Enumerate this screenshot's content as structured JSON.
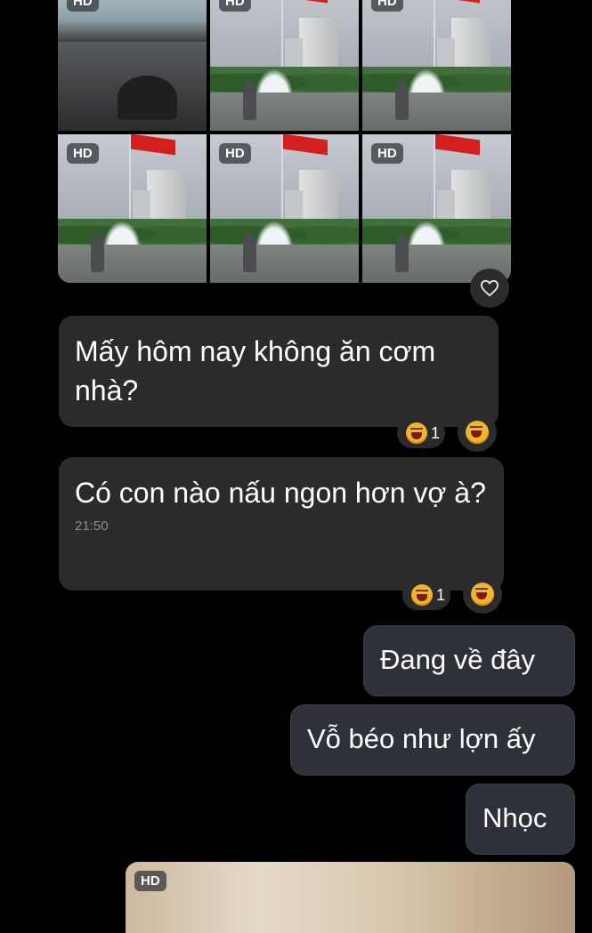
{
  "photo_grid": {
    "hd_label": "HD",
    "photo_count": 6
  },
  "messages": [
    {
      "side": "incoming",
      "text": "Mấy hôm nay không ăn cơm nhà?",
      "reaction_count": "1"
    },
    {
      "side": "incoming",
      "text": "Có con nào nấu ngon hơn vợ à?",
      "time": "21:50",
      "reaction_count": "1"
    },
    {
      "side": "outgoing",
      "text": "Đang về đây"
    },
    {
      "side": "outgoing",
      "text": "Vỗ béo như lợn ấy"
    },
    {
      "side": "outgoing",
      "text": "Nhọc"
    }
  ],
  "bottom_photo": {
    "hd_label": "HD"
  },
  "icons": {
    "heart": "heart-icon",
    "reaction": "laughing-face-emoji"
  },
  "colors": {
    "background": "#000000",
    "incoming_bubble": "#2b2b2d",
    "outgoing_bubble": "#2e3138",
    "flag_red": "#d41f1f"
  }
}
